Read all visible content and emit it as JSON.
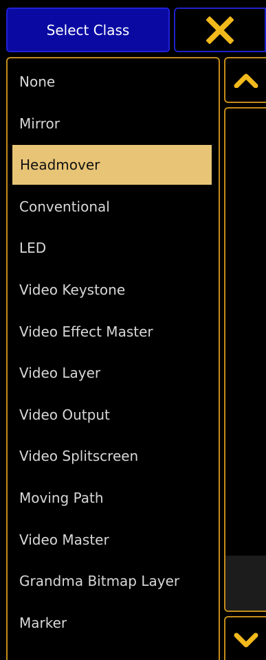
{
  "dialog": {
    "title": "Select Class",
    "close_icon": "close-x-icon"
  },
  "list": {
    "selected_index": 2,
    "items": [
      {
        "label": "None"
      },
      {
        "label": "Mirror"
      },
      {
        "label": "Headmover"
      },
      {
        "label": "Conventional"
      },
      {
        "label": "LED"
      },
      {
        "label": "Video Keystone"
      },
      {
        "label": "Video Effect Master"
      },
      {
        "label": "Video Layer"
      },
      {
        "label": "Video Output"
      },
      {
        "label": "Video Splitscreen"
      },
      {
        "label": "Moving Path"
      },
      {
        "label": "Video Master"
      },
      {
        "label": "Grandma Bitmap Layer"
      },
      {
        "label": "Marker"
      }
    ]
  },
  "scrollbar": {
    "up_icon": "chevron-up-icon",
    "down_icon": "chevron-down-icon",
    "thumb_start_fraction": 0.89,
    "thumb_end_fraction": 1.0
  },
  "colors": {
    "title_bg": "#0a0aa3",
    "accent_border": "#c58c1a",
    "selected_bg": "#e8c476",
    "icon": "#f2b91c",
    "text": "#d8d8d8"
  }
}
